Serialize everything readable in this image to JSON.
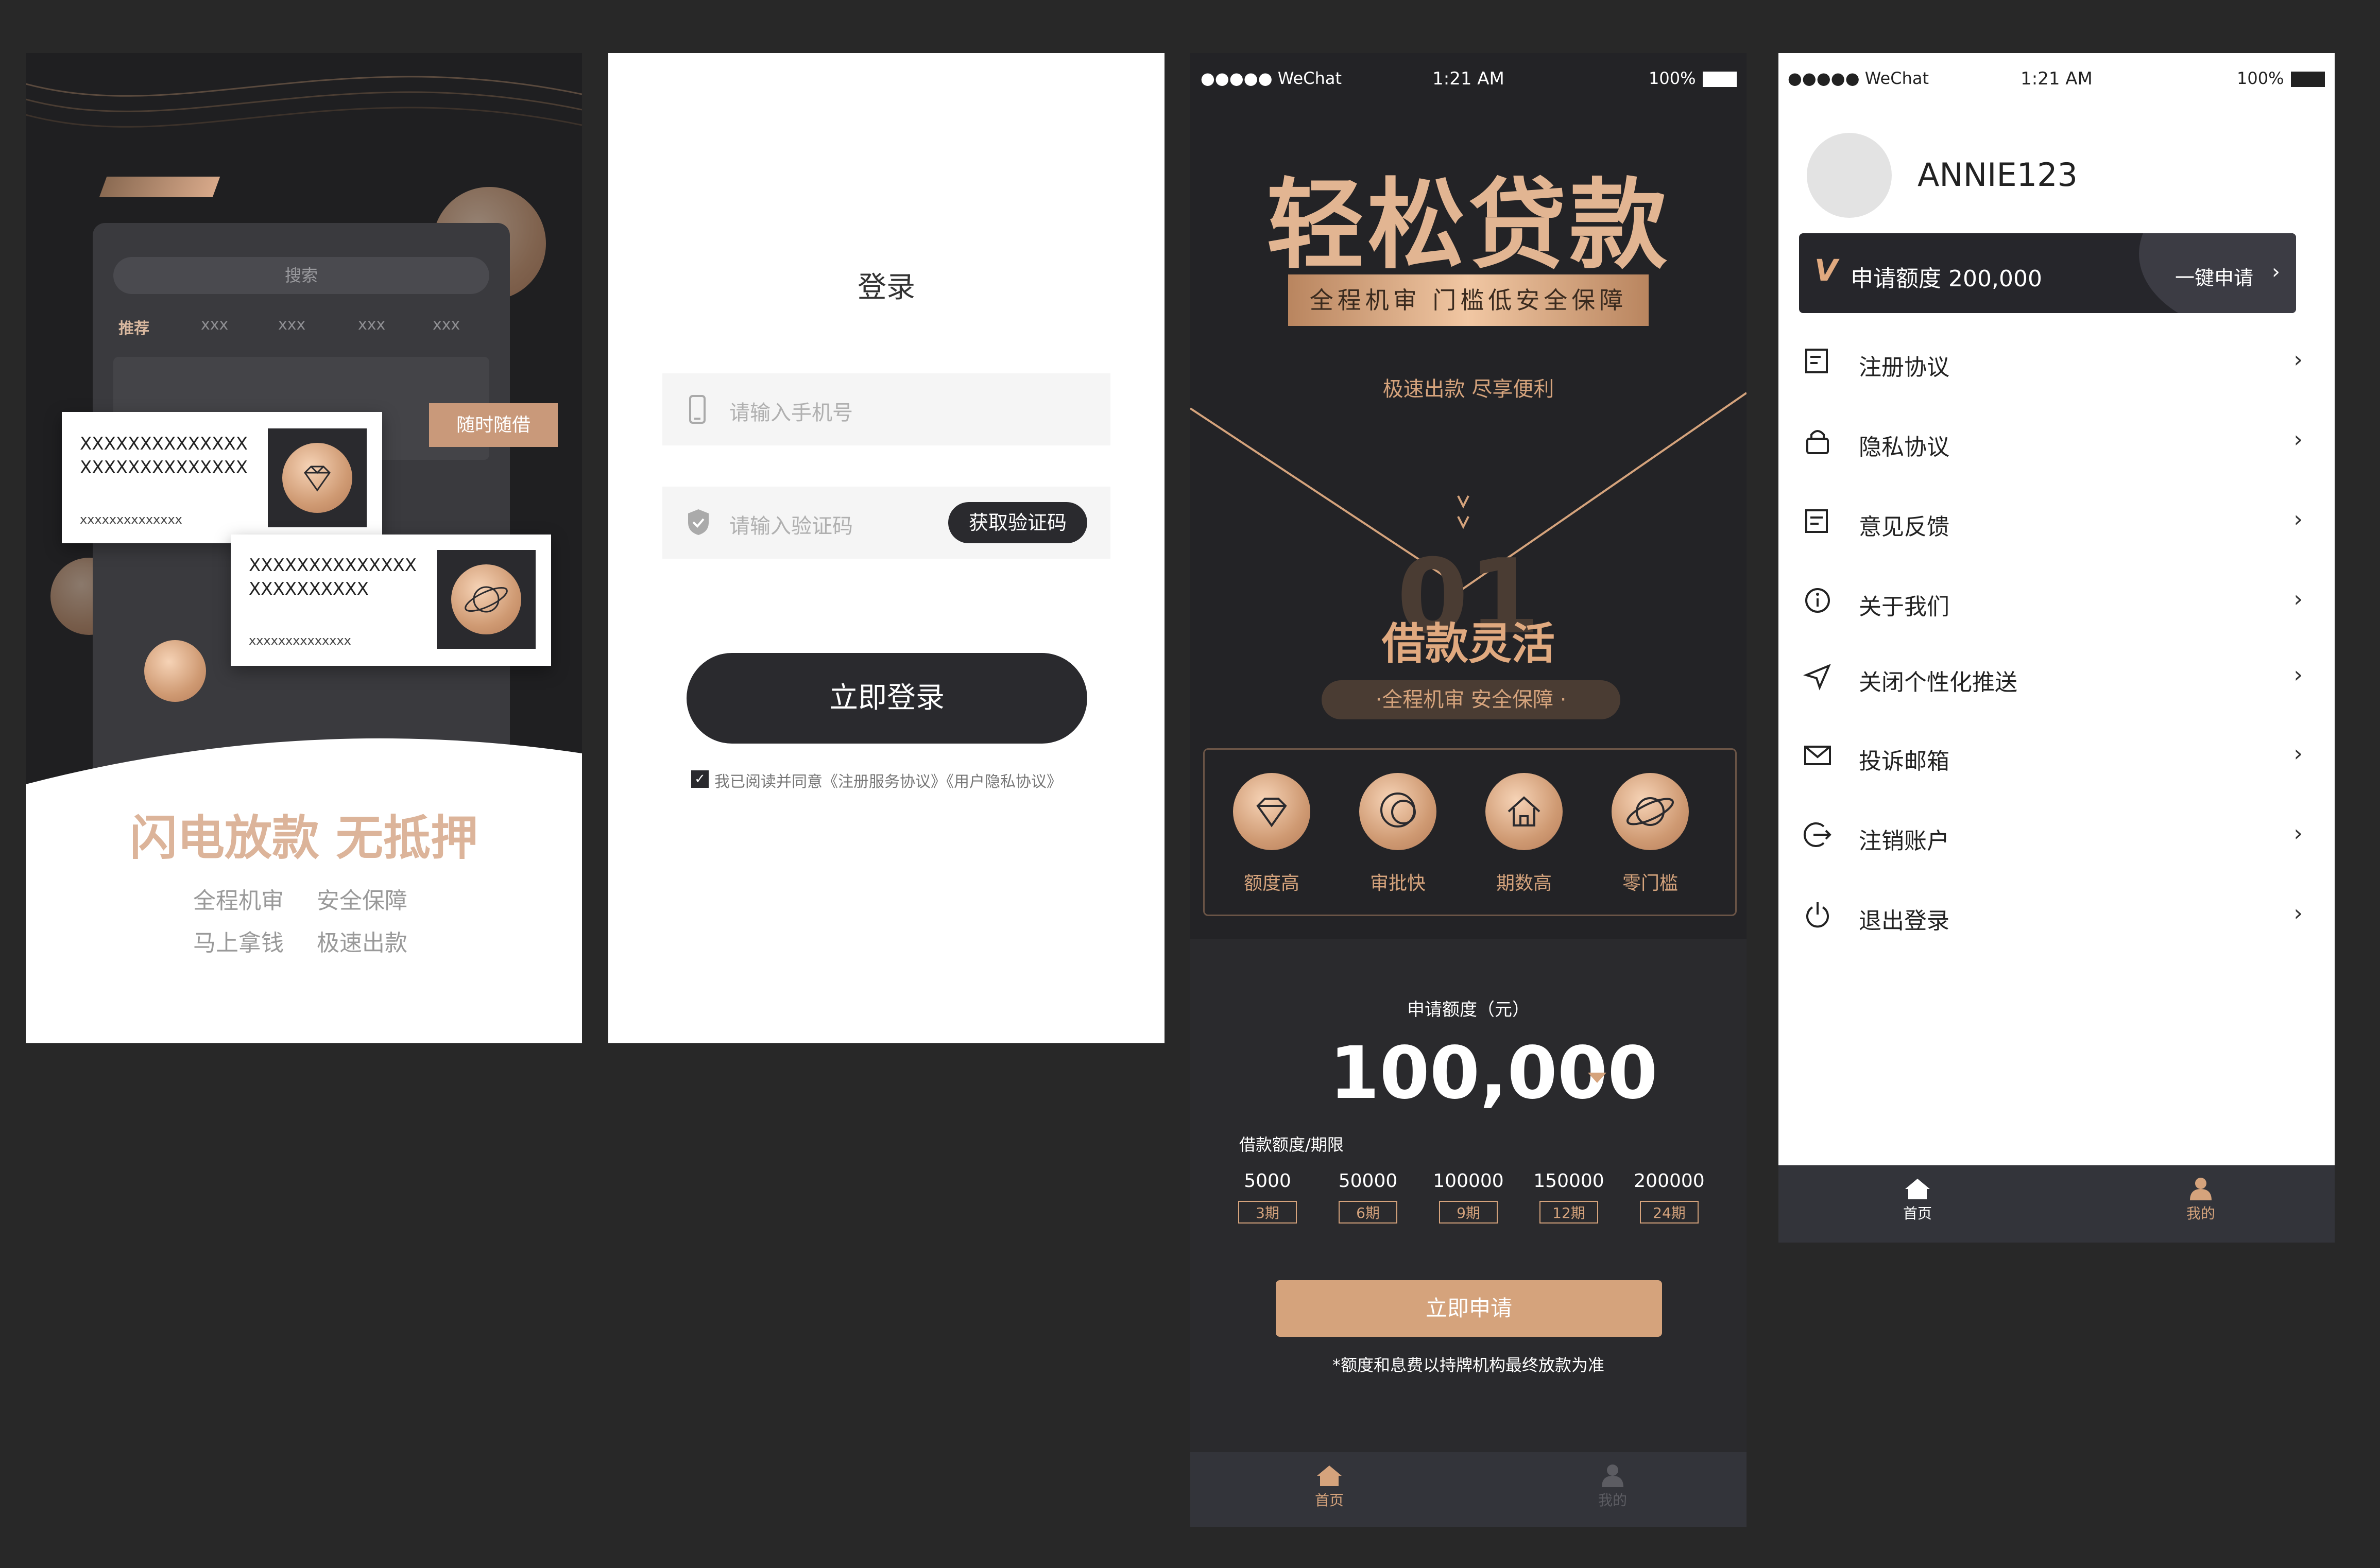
{
  "screen1": {
    "search_placeholder": "搜索",
    "tabs": [
      "推荐",
      "xxx",
      "xxx",
      "xxx",
      "xxx"
    ],
    "tag": "随时随借",
    "card1": {
      "line1": "XXXXXXXXXXXXXX",
      "line2": "XXXXXXXXXXXXXX",
      "small": "xxxxxxxxxxxxxx"
    },
    "card2": {
      "line1": "XXXXXXXXXXXXXX",
      "line2": "XXXXXXXXXX",
      "small": "xxxxxxxxxxxxxx"
    },
    "headline": "闪电放款 无抵押",
    "sub1a": "全程机审",
    "sub1b": "安全保障",
    "sub2a": "马上拿钱",
    "sub2b": "极速出款"
  },
  "screen2": {
    "title": "登录",
    "phone_placeholder": "请输入手机号",
    "code_placeholder": "请输入验证码",
    "get_code": "获取验证码",
    "login_button": "立即登录",
    "agree_text": "我已阅读并同意《注册服务协议》《用户隐私协议》"
  },
  "screen3": {
    "status": {
      "carrier": "●●●●● WeChat",
      "time": "1:21 AM",
      "battery": "100%"
    },
    "hero_title": "轻松贷款",
    "ribbon": "全程机审 门槛低安全保障",
    "tagline": "极速出款 尽享便利",
    "big_number": "01",
    "section_title": "借款灵活",
    "pill": "·全程机审 安全保障 ·",
    "features": [
      {
        "label": "额度高",
        "icon": "diamond-icon"
      },
      {
        "label": "审批快",
        "icon": "chat-bubble-icon"
      },
      {
        "label": "期数高",
        "icon": "home-icon"
      },
      {
        "label": "零门槛",
        "icon": "planet-icon"
      }
    ],
    "amount_label": "申请额度（元）",
    "amount_value": "100,000",
    "term_label": "借款额度/期限",
    "options": [
      {
        "amount": "5000",
        "term": "3期"
      },
      {
        "amount": "50000",
        "term": "6期"
      },
      {
        "amount": "100000",
        "term": "9期"
      },
      {
        "amount": "150000",
        "term": "12期"
      },
      {
        "amount": "200000",
        "term": "24期"
      }
    ],
    "apply_button": "立即申请",
    "disclaimer": "*额度和息费以持牌机构最终放款为准",
    "nav": [
      {
        "label": "首页",
        "icon": "home-icon"
      },
      {
        "label": "我的",
        "icon": "person-icon"
      }
    ]
  },
  "screen4": {
    "status": {
      "carrier": "●●●●● WeChat",
      "time": "1:21 AM",
      "battery": "100%"
    },
    "username": "ANNIE123",
    "banner_label": "申请额度 200,000",
    "banner_action": "一键申请",
    "menu": [
      {
        "label": "注册协议",
        "icon": "register-icon"
      },
      {
        "label": "隐私协议",
        "icon": "lock-icon"
      },
      {
        "label": "意见反馈",
        "icon": "feedback-icon"
      },
      {
        "label": "关于我们",
        "icon": "info-icon"
      },
      {
        "label": "关闭个性化推送",
        "icon": "send-icon"
      },
      {
        "label": "投诉邮箱",
        "icon": "mail-icon"
      },
      {
        "label": "注销账户",
        "icon": "logout-circle-icon"
      },
      {
        "label": "退出登录",
        "icon": "power-icon"
      }
    ],
    "nav": [
      {
        "label": "首页",
        "icon": "home-icon"
      },
      {
        "label": "我的",
        "icon": "person-icon"
      }
    ]
  },
  "colors": {
    "gold": "#d5a37c",
    "dark": "#2a2a2d",
    "nav": "#33343a"
  }
}
